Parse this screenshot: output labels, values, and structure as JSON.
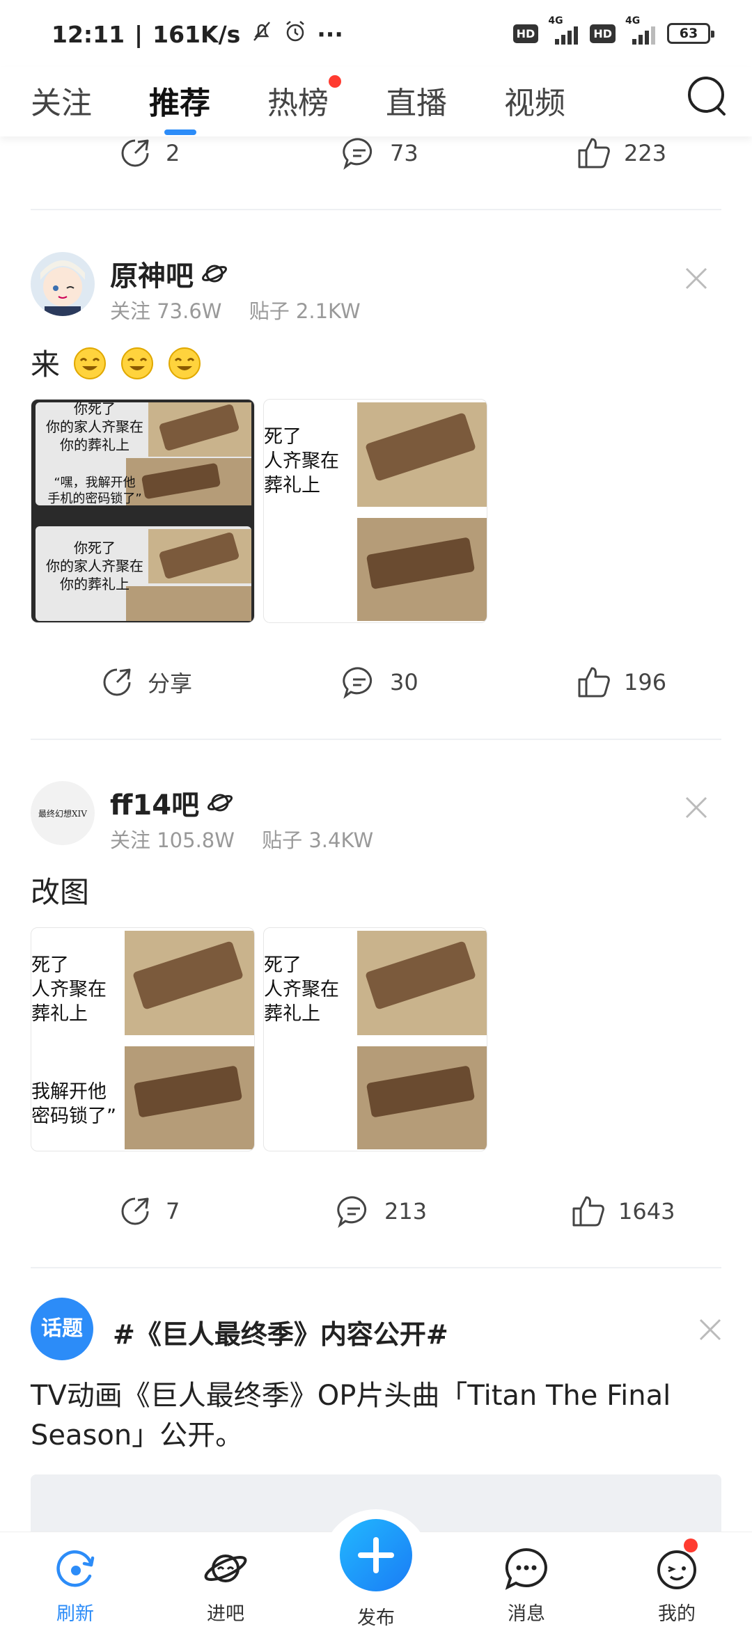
{
  "status_bar": {
    "time": "12:11",
    "speed": "161K/s",
    "more": "···",
    "hd1": "HD",
    "net1": "4G",
    "hd2": "HD",
    "net2": "4G",
    "battery": "63"
  },
  "tabs": [
    {
      "label": "关注"
    },
    {
      "label": "推荐"
    },
    {
      "label": "热榜"
    },
    {
      "label": "直播"
    },
    {
      "label": "视频"
    }
  ],
  "posts": [
    {
      "actions": {
        "share": "2",
        "comment": "73",
        "like": "223"
      }
    },
    {
      "forum": "原神吧",
      "follow": "关注 73.6W",
      "posts": "贴子 2.1KW",
      "text": "来",
      "images": [
        {
          "lines": [
            "你死了",
            "你的家人齐聚在",
            "你的葬礼上",
            "“嘿，我解开他",
            "手机的密码锁了”",
            "你死了",
            "你的家人齐聚在",
            "你的葬礼上"
          ]
        },
        {
          "lines": [
            "死了",
            "人齐聚在",
            "葬礼上"
          ]
        }
      ],
      "actions": {
        "share": "分享",
        "comment": "30",
        "like": "196"
      }
    },
    {
      "forum": "ff14吧",
      "avatar_text": "最终幻想XIV",
      "follow": "关注 105.8W",
      "posts": "贴子 3.4KW",
      "text": "改图",
      "images": [
        {
          "lines": [
            "死了",
            "人齐聚在",
            "葬礼上",
            "我解开他",
            "密码锁了”"
          ]
        },
        {
          "lines": [
            "死了",
            "人齐聚在",
            "葬礼上"
          ]
        }
      ],
      "actions": {
        "share": "7",
        "comment": "213",
        "like": "1643"
      }
    },
    {
      "badge": "话题",
      "title": "#《巨人最终季》内容公开#",
      "body": "TV动画《巨人最终季》OP片头曲「Titan The Final Season」公开。"
    }
  ],
  "bottom_nav": [
    {
      "label": "刷新"
    },
    {
      "label": "进吧"
    },
    {
      "label": "发布"
    },
    {
      "label": "消息"
    },
    {
      "label": "我的"
    }
  ],
  "colors": {
    "accent": "#2c8cf8",
    "badge": "#ff3b30"
  }
}
